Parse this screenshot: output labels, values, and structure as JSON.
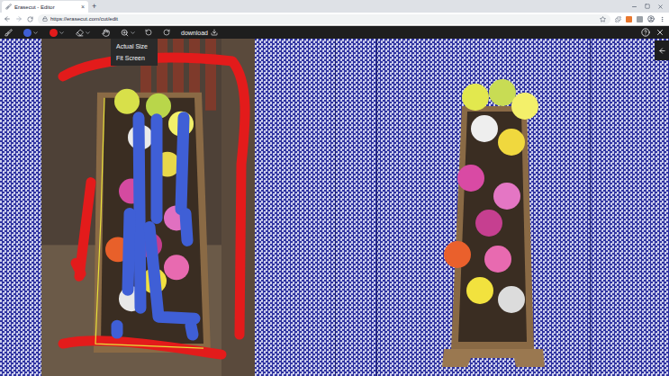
{
  "browser": {
    "tabs": [
      {
        "title": "Erasecut - Editor",
        "selected": true,
        "close": "×"
      }
    ],
    "new_tab": "+",
    "url": "https://erasecut.com/cut/edit"
  },
  "toolbar": {
    "keep_color": "#3f5fd6",
    "remove_color": "#e31b1b",
    "download": "download"
  },
  "zoom_menu": {
    "open": true,
    "items": [
      {
        "label": "Actual Size",
        "selected": false
      },
      {
        "label": "Fit Screen",
        "selected": false
      }
    ]
  }
}
